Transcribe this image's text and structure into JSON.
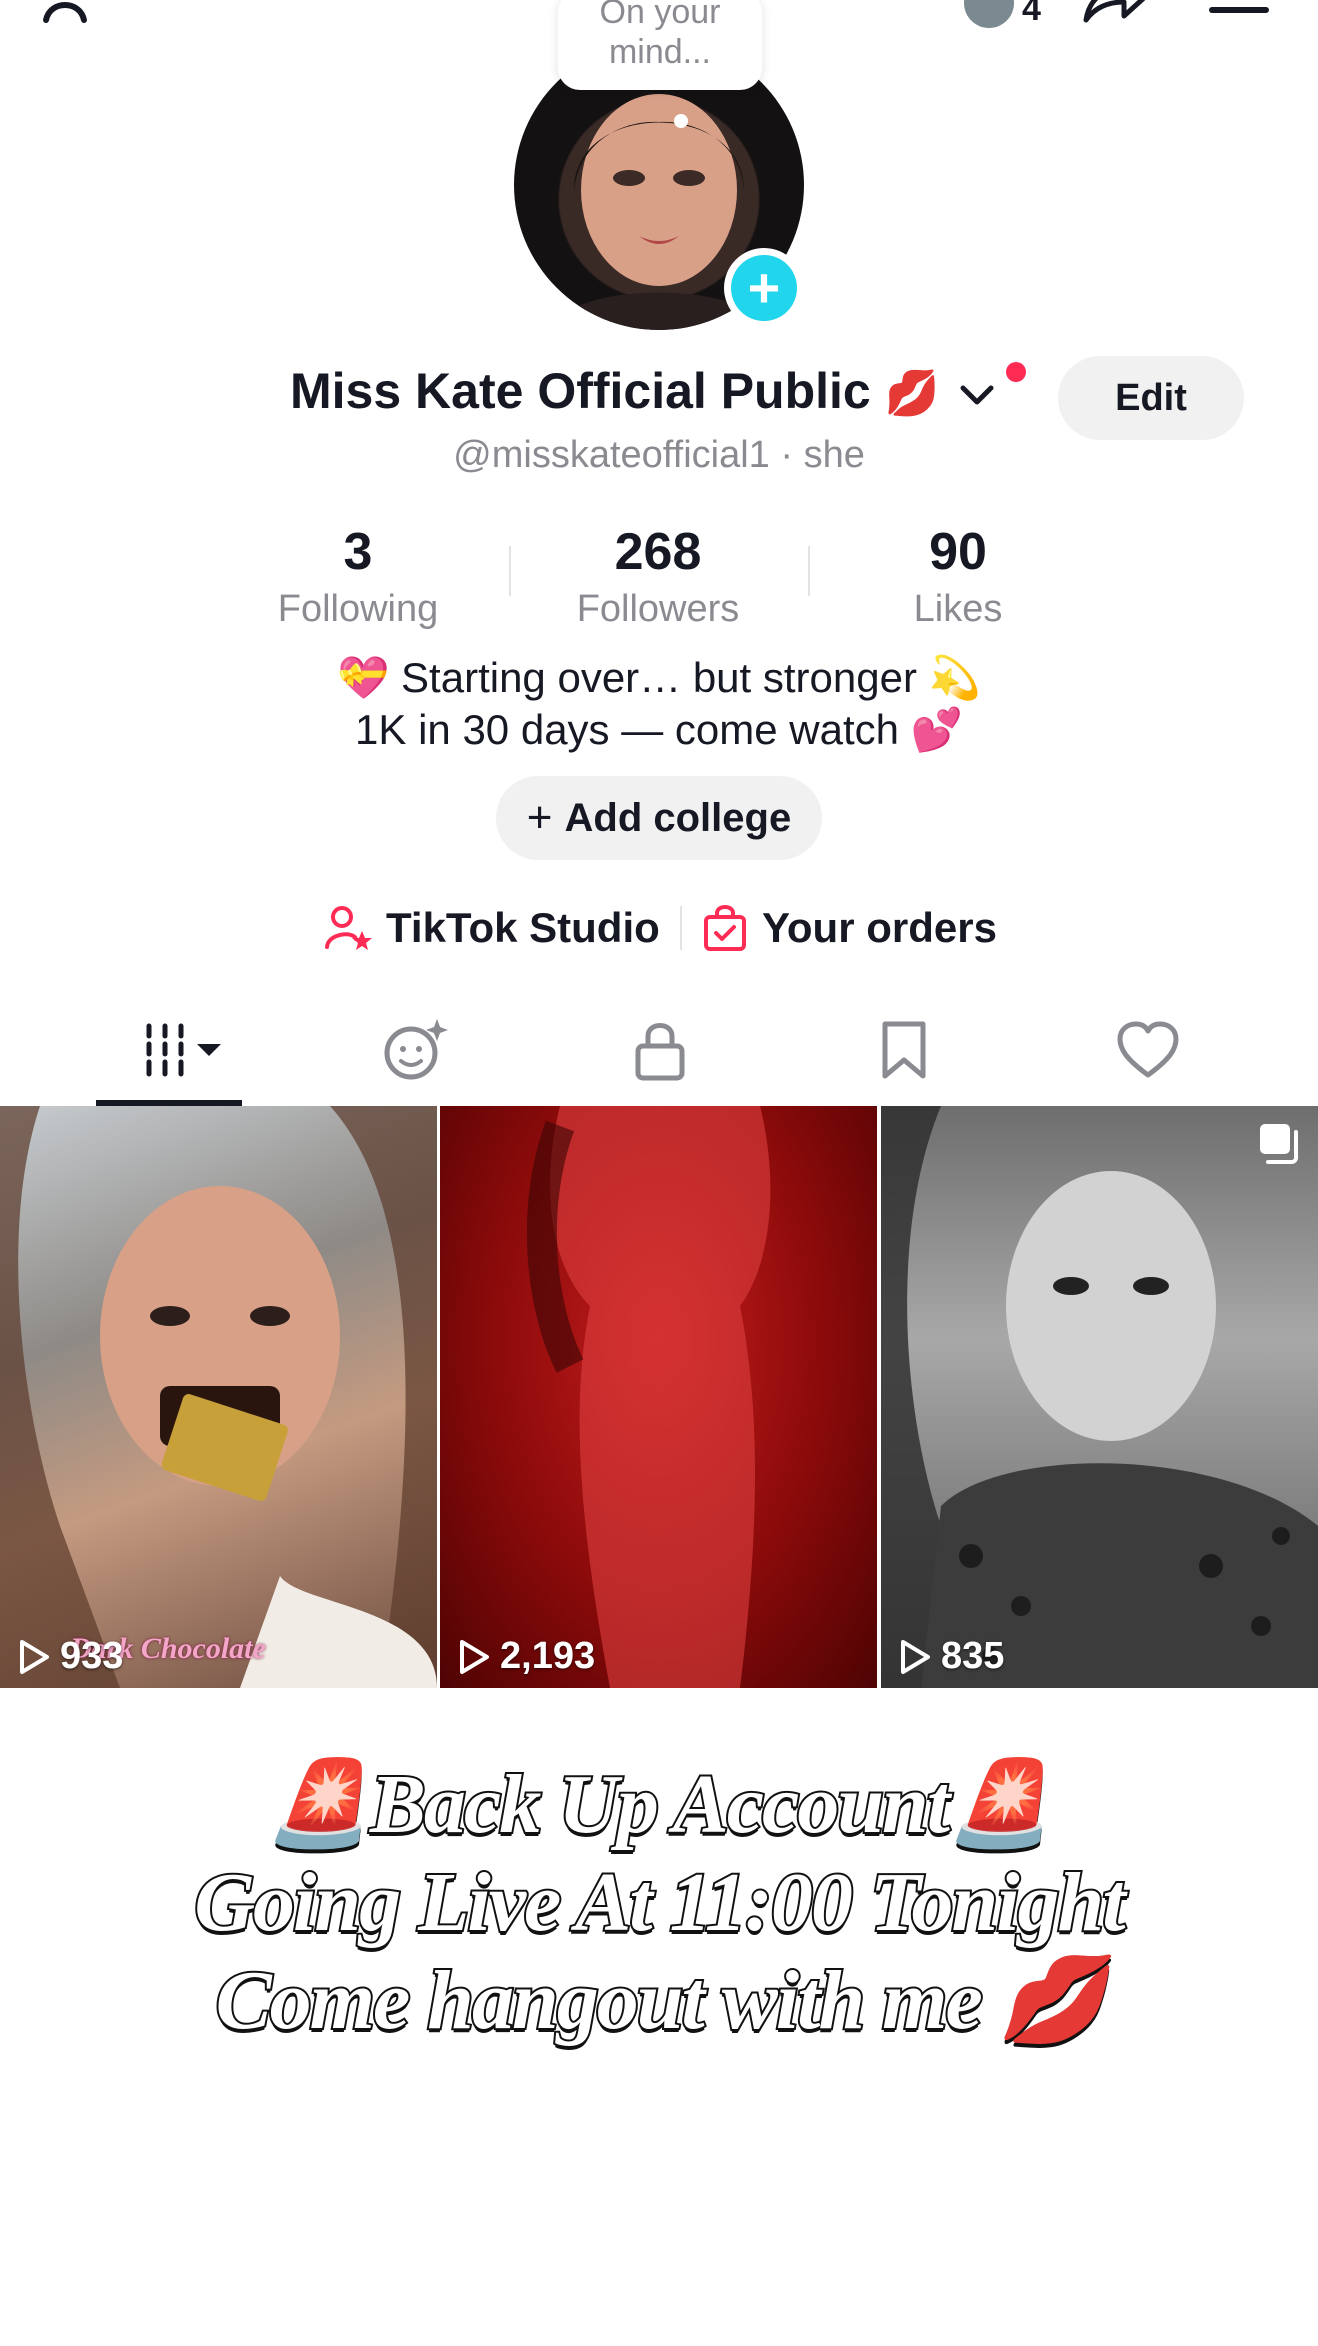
{
  "header": {
    "mind_bubble_line1": "On your",
    "mind_bubble_line2": "mind...",
    "friends_count": "4"
  },
  "profile": {
    "name": "Miss Kate Official Public",
    "name_emoji": "💋",
    "edit_label": "Edit",
    "handle": "@misskateofficial1 · she"
  },
  "stats": [
    {
      "value": "3",
      "label": "Following"
    },
    {
      "value": "268",
      "label": "Followers"
    },
    {
      "value": "90",
      "label": "Likes"
    }
  ],
  "bio": {
    "line1": "💝 Starting over… but stronger 💫",
    "line2": "1K in 30 days — come watch 💕"
  },
  "add_college_label": "Add college",
  "links": {
    "studio_label": "TikTok Studio",
    "orders_label": "Your orders"
  },
  "tabs": [
    "videos",
    "reposts",
    "private",
    "favorites",
    "liked"
  ],
  "videos": [
    {
      "views": "933",
      "overlay_text": "Dark Chocolate"
    },
    {
      "views": "2,193"
    },
    {
      "views": "835"
    }
  ],
  "promo": {
    "line1": "🚨Back Up Account🚨",
    "line2": "Going Live At 11:00 Tonight",
    "line3": "Come hangout with me 💋"
  },
  "colors": {
    "accent_red": "#fe2c55",
    "plus_cyan": "#20d5ec",
    "muted_text": "#8a8b91"
  }
}
